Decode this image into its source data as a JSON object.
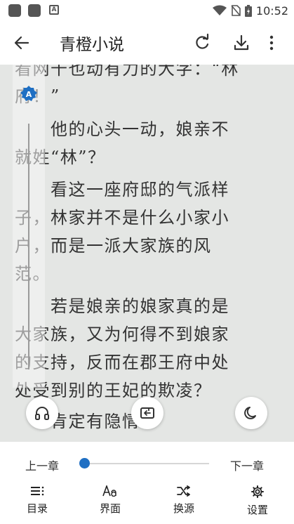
{
  "status_bar": {
    "time": "10:52",
    "app_badge": "A"
  },
  "app_bar": {
    "title": "青橙小说"
  },
  "reader": {
    "lines": [
      "看网千也动有力的大字：“林",
      "府！”",
      "　　他的心头一动，娘亲不",
      "就姓“林”？",
      "　　看这一座府邸的气派样",
      "子，林家并不是什么小家小",
      "户，而是一派大家族的风",
      "范。",
      "　　若是娘亲的娘家真的是",
      "大家族，又为何得不到娘家",
      "的支持，反而在郡王府中处",
      "处受到别的王妃的欺凌？",
      "　　肯定有隐情。"
    ],
    "side_badge": "A"
  },
  "chapter_nav": {
    "prev_label": "上一章",
    "next_label": "下一章",
    "progress": 0
  },
  "bottom_menu": [
    {
      "label": "目录",
      "icon": "catalog-icon"
    },
    {
      "label": "界面",
      "icon": "font-icon"
    },
    {
      "label": "换源",
      "icon": "shuffle-icon"
    },
    {
      "label": "设置",
      "icon": "gear-icon"
    }
  ]
}
